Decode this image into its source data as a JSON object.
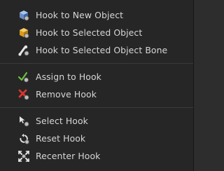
{
  "menu": {
    "groups": [
      {
        "items": [
          {
            "label": "Hook to New Object",
            "icon": "new-object-icon"
          },
          {
            "label": "Hook to Selected Object",
            "icon": "selected-object-icon"
          },
          {
            "label": "Hook to Selected Object Bone",
            "icon": "selected-object-bone-icon"
          }
        ]
      },
      {
        "items": [
          {
            "label": "Assign to Hook",
            "icon": "assign-hook-icon"
          },
          {
            "label": "Remove Hook",
            "icon": "remove-hook-icon"
          }
        ]
      },
      {
        "items": [
          {
            "label": "Select Hook",
            "icon": "select-hook-icon"
          },
          {
            "label": "Reset Hook",
            "icon": "reset-hook-icon"
          },
          {
            "label": "Recenter Hook",
            "icon": "recenter-hook-icon"
          }
        ]
      }
    ]
  },
  "colors": {
    "menu_bg": "#262626",
    "text": "#d6d6d6",
    "separator": "#3a3a3a",
    "accent_blue": "#5b8fd6",
    "accent_yellow": "#e0a51a",
    "accent_green": "#67c13a",
    "accent_red": "#d8352e"
  }
}
